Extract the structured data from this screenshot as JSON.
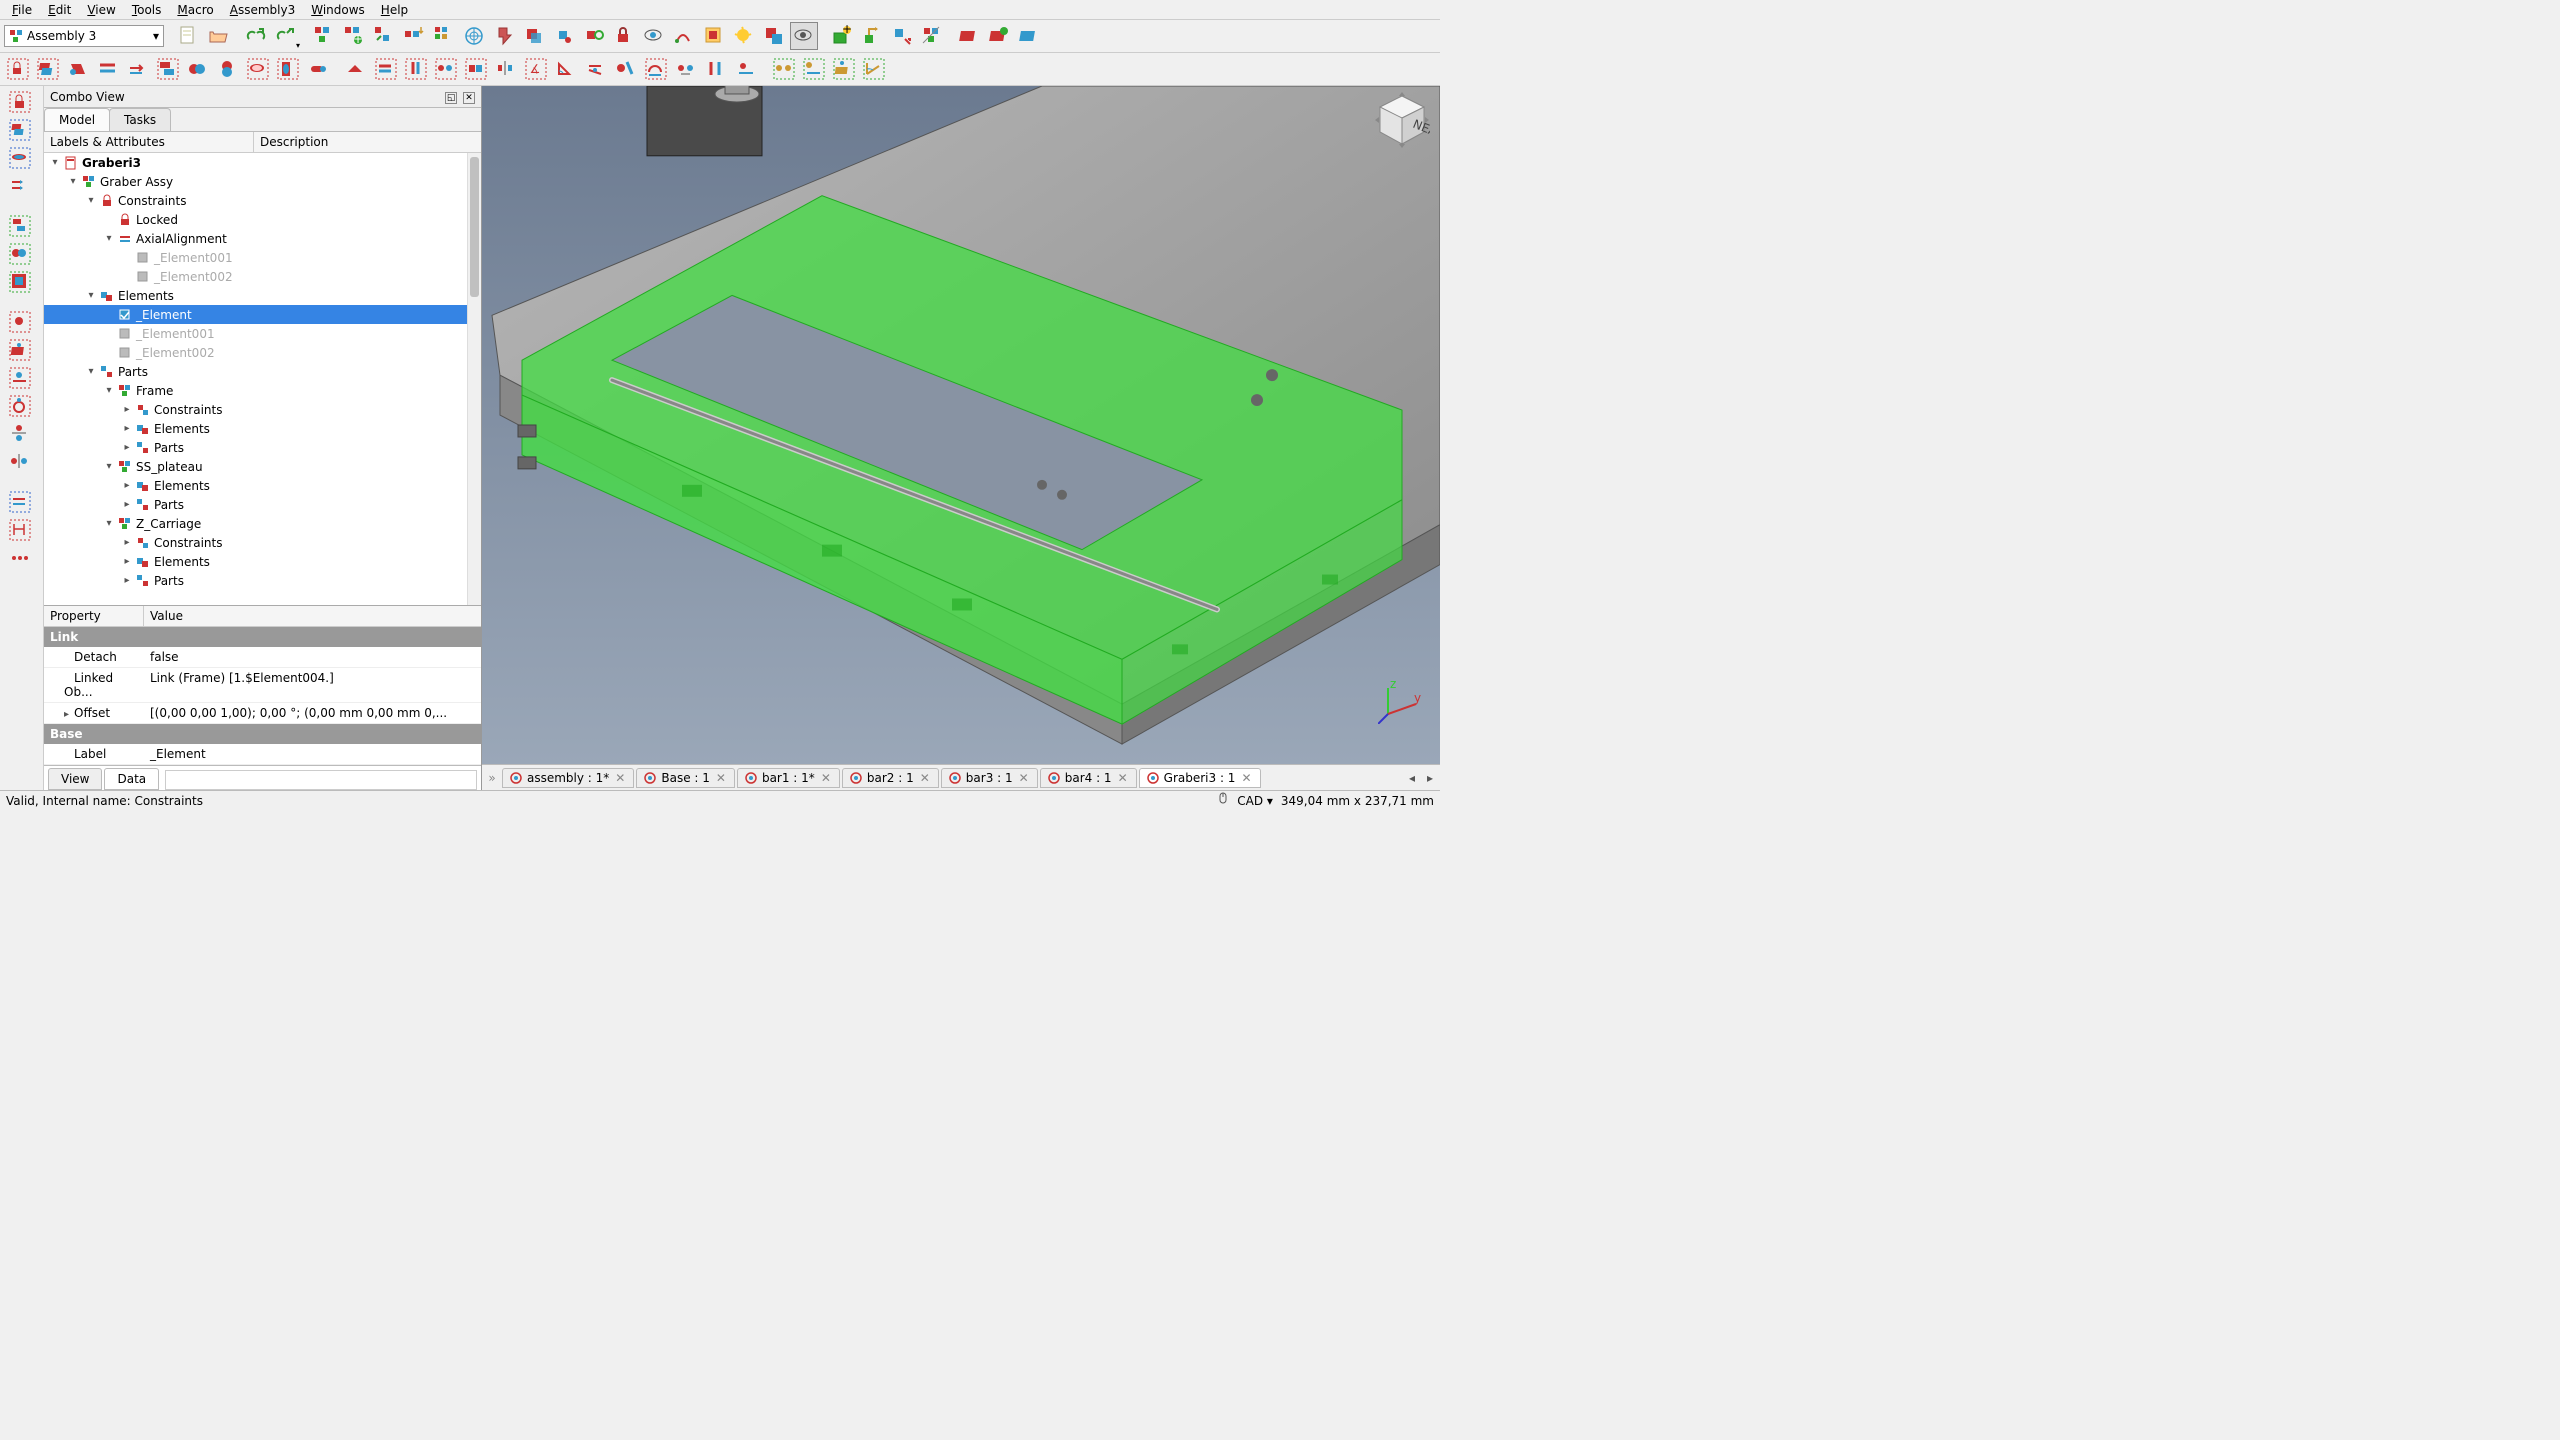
{
  "menus": [
    "File",
    "Edit",
    "View",
    "Tools",
    "Macro",
    "Assembly3",
    "Windows",
    "Help"
  ],
  "menu_accel": [
    "F",
    "E",
    "V",
    "T",
    "M",
    "A",
    "W",
    "H"
  ],
  "workbench": {
    "label": "Assembly 3"
  },
  "combo": {
    "title": "Combo View",
    "tabs": {
      "model": "Model",
      "tasks": "Tasks"
    },
    "headers": {
      "labels": "Labels & Attributes",
      "desc": "Description"
    }
  },
  "tree": [
    {
      "depth": 0,
      "exp": "▾",
      "bold": true,
      "icon": "doc",
      "label": "Graberi3"
    },
    {
      "depth": 1,
      "exp": "▾",
      "icon": "asm",
      "label": "Graber Assy"
    },
    {
      "depth": 2,
      "exp": "▾",
      "icon": "lock",
      "label": "Constraints"
    },
    {
      "depth": 3,
      "exp": "",
      "icon": "lock",
      "label": "Locked"
    },
    {
      "depth": 3,
      "exp": "▾",
      "icon": "axial",
      "label": "AxialAlignment"
    },
    {
      "depth": 4,
      "exp": "",
      "icon": "elem",
      "dim": true,
      "label": "_Element001"
    },
    {
      "depth": 4,
      "exp": "",
      "icon": "elem",
      "dim": true,
      "label": "_Element002"
    },
    {
      "depth": 2,
      "exp": "▾",
      "icon": "elems",
      "label": "Elements"
    },
    {
      "depth": 3,
      "exp": "",
      "icon": "elemsel",
      "selected": true,
      "label": "_Element"
    },
    {
      "depth": 3,
      "exp": "",
      "icon": "elem",
      "dim": true,
      "label": "_Element001"
    },
    {
      "depth": 3,
      "exp": "",
      "icon": "elem",
      "dim": true,
      "label": "_Element002"
    },
    {
      "depth": 2,
      "exp": "▾",
      "icon": "parts",
      "label": "Parts"
    },
    {
      "depth": 3,
      "exp": "▾",
      "icon": "part",
      "label": "Frame"
    },
    {
      "depth": 4,
      "exp": "▸",
      "icon": "constr",
      "label": "Constraints"
    },
    {
      "depth": 4,
      "exp": "▸",
      "icon": "elems",
      "label": "Elements"
    },
    {
      "depth": 4,
      "exp": "▸",
      "icon": "parts",
      "label": "Parts"
    },
    {
      "depth": 3,
      "exp": "▾",
      "icon": "part",
      "label": "SS_plateau"
    },
    {
      "depth": 4,
      "exp": "▸",
      "icon": "elems",
      "label": "Elements"
    },
    {
      "depth": 4,
      "exp": "▸",
      "icon": "parts",
      "label": "Parts"
    },
    {
      "depth": 3,
      "exp": "▾",
      "icon": "part",
      "label": "Z_Carriage"
    },
    {
      "depth": 4,
      "exp": "▸",
      "icon": "constr",
      "label": "Constraints"
    },
    {
      "depth": 4,
      "exp": "▸",
      "icon": "elems",
      "label": "Elements"
    },
    {
      "depth": 4,
      "exp": "▸",
      "icon": "parts",
      "label": "Parts"
    }
  ],
  "props": {
    "headers": {
      "prop": "Property",
      "val": "Value"
    },
    "groups": [
      {
        "name": "Link",
        "rows": [
          {
            "name": "Detach",
            "val": "false"
          },
          {
            "name": "Linked Ob...",
            "val": "Link (Frame) [1.$Element004.]"
          },
          {
            "name": "Offset",
            "val": "[(0,00 0,00 1,00); 0,00 °; (0,00 mm  0,00 mm  0,...",
            "exp": "▸"
          }
        ]
      },
      {
        "name": "Base",
        "rows": [
          {
            "name": "Label",
            "val": "_Element"
          }
        ]
      }
    ],
    "tabs": {
      "view": "View",
      "data": "Data"
    }
  },
  "doc_tabs": [
    {
      "label": "assembly : 1*"
    },
    {
      "label": "Base : 1"
    },
    {
      "label": "bar1 : 1*"
    },
    {
      "label": "bar2 : 1"
    },
    {
      "label": "bar3 : 1"
    },
    {
      "label": "bar4 : 1"
    },
    {
      "label": "Graberi3 : 1",
      "active": true
    }
  ],
  "status": {
    "left": "Valid, Internal name: Constraints",
    "nav": "CAD",
    "dims": "349,04 mm x 237,71 mm"
  },
  "navcube": {
    "face": "NEAR"
  }
}
